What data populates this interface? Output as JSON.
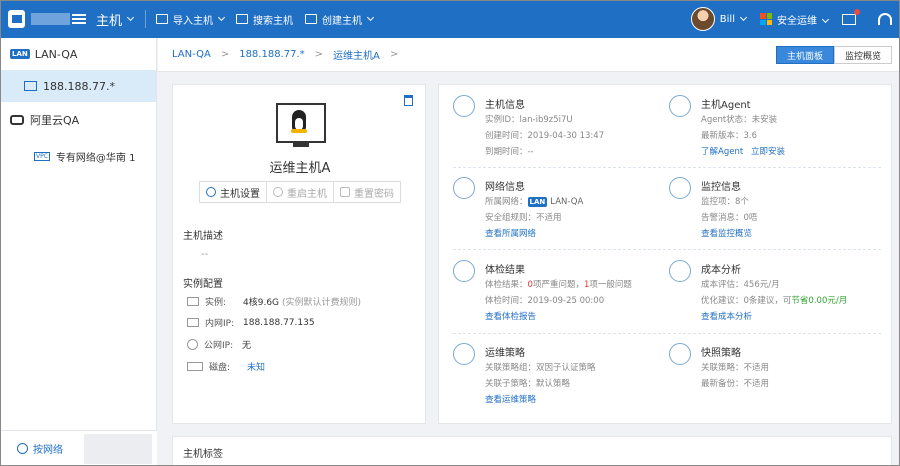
{
  "topbar": {
    "title": "主机",
    "import_host": "导入主机",
    "search_host": "搜索主机",
    "create_host": "创建主机",
    "user": "Bill",
    "ops_security": "安全运维"
  },
  "sidebar": {
    "items": [
      {
        "badge": "LAN",
        "label": "LAN-QA"
      },
      {
        "label": "188.188.77.*"
      },
      {
        "label": "阿里云QA"
      },
      {
        "badge": "VPC",
        "label": "专有网络@华南 1"
      }
    ],
    "bottom_tab": "按网络"
  },
  "breadcrumb": {
    "items": [
      "LAN-QA",
      "188.188.77.*",
      "运维主机A"
    ],
    "separator": ">"
  },
  "view_toggle": {
    "active": "主机面板",
    "inactive": "监控概览"
  },
  "host": {
    "name": "运维主机A",
    "actions": [
      "主机设置",
      "重启主机",
      "重置密码"
    ],
    "description_label": "主机描述",
    "description_value": "--",
    "config_label": "实例配置",
    "rows": [
      {
        "label": "实例:",
        "value": "4核9.6G",
        "note": "(实例默认计费规则)"
      },
      {
        "label": "内网IP:",
        "value": "188.188.77.135"
      },
      {
        "label": "公网IP:",
        "value": "无"
      },
      {
        "label": "磁盘:",
        "value": "未知"
      }
    ]
  },
  "info_blocks": {
    "host_info": {
      "title": "主机信息",
      "lines": [
        "实例ID：lan-ib9z5i7U",
        "创建时间：2019-04-30 13:47",
        "到期时间：--"
      ]
    },
    "agent": {
      "title": "主机Agent",
      "lines": [
        "Agent状态：未安装",
        "最新版本：3.6"
      ],
      "link1": "了解Agent",
      "link2": "立即安装"
    },
    "network": {
      "title": "网络信息",
      "network_prefix": "所属网络：",
      "network_badge": "LAN",
      "network_value": "LAN-QA",
      "line2": "安全组规则：不适用",
      "link": "查看所属网络"
    },
    "monitor": {
      "title": "监控信息",
      "lines": [
        "监控项：8个",
        "告警消息：0唔"
      ],
      "link": "查看监控概览"
    },
    "checkup": {
      "title": "体检结果",
      "result_prefix": "体检结果：",
      "serious_count": "0",
      "serious_text": "项严重问题，",
      "general_count": "1",
      "general_text": "项一般问题",
      "line2": "体检时间：2019-09-25 00:00",
      "link": "查看体检报告"
    },
    "cost": {
      "title": "成本分析",
      "line1": "成本评估：456元/月",
      "suggest_prefix": "优化建议：0条建议，可",
      "saving": "节省0.00元/月",
      "link": "查看成本分析"
    },
    "ops_policy": {
      "title": "运维策略",
      "lines": [
        "关联策略组：双因子认证策略",
        "关联子策略：默认策略"
      ],
      "link": "查看运维策略"
    },
    "snapshot": {
      "title": "快照策略",
      "lines": [
        "关联策略：不适用",
        "最新备份：不适用"
      ]
    }
  },
  "tags": {
    "title": "主机标签"
  },
  "colors": {
    "primary": "#1f6fc5",
    "danger": "#e33333",
    "success": "#2fa52f"
  }
}
